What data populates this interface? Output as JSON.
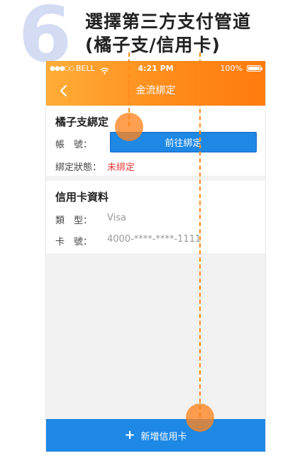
{
  "step": {
    "number": "6",
    "title_line1": "選擇第三方支付管道",
    "title_line2": "(橘子支/信用卡)"
  },
  "status_bar": {
    "signal": "●●●○○",
    "carrier": "BELL",
    "time": "4:21 PM",
    "battery": "100%"
  },
  "nav": {
    "title": "金流綁定",
    "back_icon": "chevron-left-icon"
  },
  "orange_pay": {
    "title": "橘子支綁定",
    "account_label": "帳　號：",
    "bind_button_label": "前往綁定",
    "status_label": "綁定狀態：",
    "status_value": "未綁定"
  },
  "credit_card": {
    "title": "信用卡資料",
    "type_label": "類　型：",
    "type_value": "Visa",
    "number_label": "卡　號：",
    "number_value": "4000-****-****-1111"
  },
  "footer": {
    "add_card_label": "新增信用卡",
    "add_icon": "plus-icon"
  },
  "colors": {
    "header_start": "#ffad38",
    "header_end": "#ff7b0e",
    "primary_blue": "#1e88e5",
    "unbound_red": "#e53935",
    "highlight_orange": "#ff8a1a"
  }
}
